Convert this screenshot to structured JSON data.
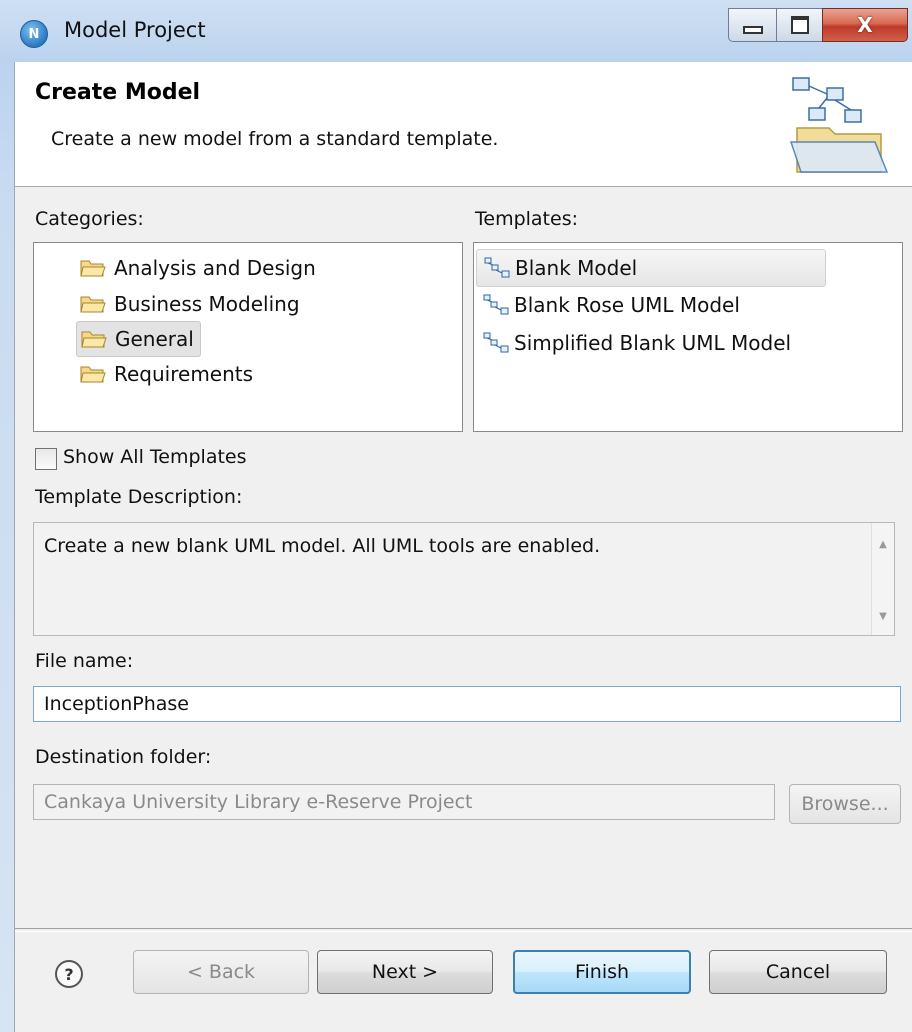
{
  "window": {
    "title": "Model Project",
    "app_icon": "N",
    "close_glyph": "X"
  },
  "header": {
    "title": "Create Model",
    "description": "Create a new model from a standard template."
  },
  "categories": {
    "label": "Categories:",
    "items": [
      {
        "label": "Analysis and Design",
        "icon": "folder-icon"
      },
      {
        "label": "Business Modeling",
        "icon": "folder-icon"
      },
      {
        "label": "General",
        "icon": "folder-icon",
        "selected": true
      },
      {
        "label": "Requirements",
        "icon": "folder-icon"
      }
    ]
  },
  "templates": {
    "label": "Templates:",
    "items": [
      {
        "label": "Blank Model",
        "icon": "uml-model-icon",
        "selected": true
      },
      {
        "label": "Blank Rose UML Model",
        "icon": "uml-model-icon"
      },
      {
        "label": "Simplified Blank UML Model",
        "icon": "uml-model-icon"
      }
    ]
  },
  "show_all": {
    "label": "Show All Templates",
    "checked": false
  },
  "template_description": {
    "label": "Template Description:",
    "text": "Create a new blank UML model. All UML tools are enabled."
  },
  "file_name": {
    "label": "File name:",
    "value": "InceptionPhase"
  },
  "destination": {
    "label": "Destination folder:",
    "value": "Cankaya University Library e-Reserve Project",
    "browse_label": "Browse..."
  },
  "footer": {
    "help_glyph": "?",
    "back": "< Back",
    "next": "Next >",
    "finish": "Finish",
    "cancel": "Cancel"
  }
}
